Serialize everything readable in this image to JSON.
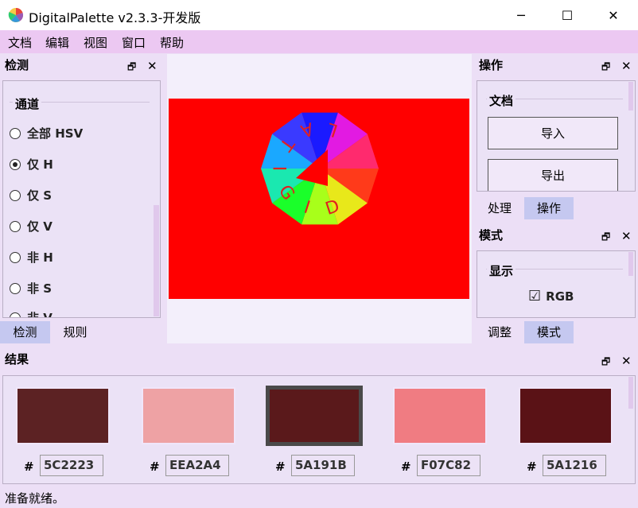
{
  "window": {
    "title": "DigitalPalette v2.3.3-开发版",
    "minimize": "─",
    "maximize": "☐",
    "close": "✕"
  },
  "menu": [
    "文档",
    "编辑",
    "视图",
    "窗口",
    "帮助"
  ],
  "left_panel": {
    "title": "检测",
    "group_title": "通道",
    "options": [
      {
        "label": "全部 HSV",
        "selected": false
      },
      {
        "label": "仅 H",
        "selected": true
      },
      {
        "label": "仅 S",
        "selected": false
      },
      {
        "label": "仅 V",
        "selected": false
      },
      {
        "label": "非 H",
        "selected": false
      },
      {
        "label": "非 S",
        "selected": false
      },
      {
        "label": "非 V",
        "selected": false
      }
    ],
    "tabs": [
      "检测",
      "规则"
    ]
  },
  "image": {
    "background_color": "#ff0000",
    "logo_letters": [
      "D",
      "I",
      "G",
      "I",
      "T",
      "A",
      "L"
    ]
  },
  "ops_panel": {
    "title": "操作",
    "group_title": "文档",
    "import_label": "导入",
    "export_label": "导出",
    "tabs": [
      "处理",
      "操作"
    ]
  },
  "mode_panel": {
    "title": "模式",
    "group_title": "显示",
    "rgb_label": "RGB",
    "rgb_checked": "☑",
    "tabs": [
      "调整",
      "模式"
    ]
  },
  "result_panel": {
    "title": "结果",
    "hash": "#",
    "swatches": [
      {
        "hex": "5C2223",
        "color": "#5c2223",
        "selected": false
      },
      {
        "hex": "EEA2A4",
        "color": "#eea2a4",
        "selected": false
      },
      {
        "hex": "5A191B",
        "color": "#5a191b",
        "selected": true
      },
      {
        "hex": "F07C82",
        "color": "#f07c82",
        "selected": false
      },
      {
        "hex": "5A1216",
        "color": "#5a1216",
        "selected": false
      }
    ]
  },
  "status": "准备就绪。",
  "icons": {
    "dock": "🗗",
    "close": "✕"
  }
}
